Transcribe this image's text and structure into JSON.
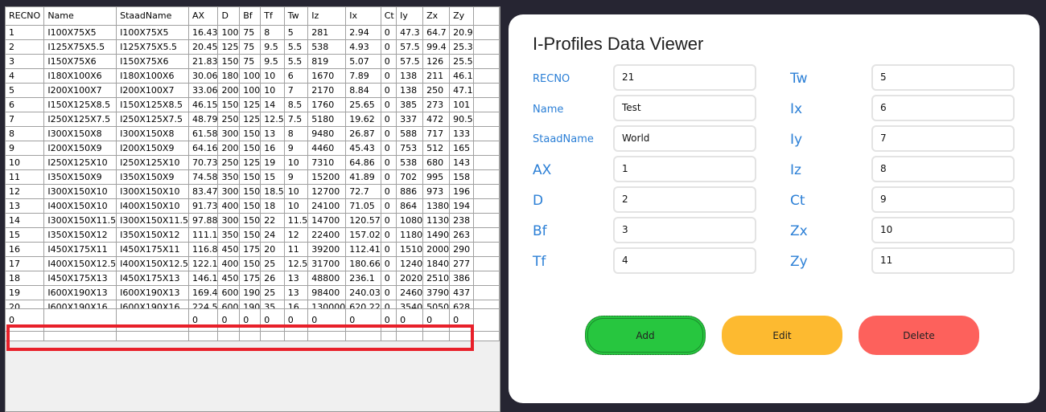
{
  "grid": {
    "columns": [
      "RECNO",
      "Name",
      "StaadName",
      "AX",
      "D",
      "Bf",
      "Tf",
      "Tw",
      "Iz",
      "Ix",
      "Ct",
      "Iy",
      "Zx",
      "Zy"
    ],
    "rows": [
      [
        "1",
        "I100X75X5",
        "I100X75X5",
        "16.43",
        "100",
        "75",
        "8",
        "5",
        "281",
        "2.94",
        "0",
        "47.3",
        "64.7",
        "20.9"
      ],
      [
        "2",
        "I125X75X5.5",
        "I125X75X5.5",
        "20.45",
        "125",
        "75",
        "9.5",
        "5.5",
        "538",
        "4.93",
        "0",
        "57.5",
        "99.4",
        "25.3"
      ],
      [
        "3",
        "I150X75X6",
        "I150X75X6",
        "21.83",
        "150",
        "75",
        "9.5",
        "5.5",
        "819",
        "5.07",
        "0",
        "57.5",
        "126",
        "25.5"
      ],
      [
        "4",
        "I180X100X6",
        "I180X100X6",
        "30.06",
        "180",
        "100",
        "10",
        "6",
        "1670",
        "7.89",
        "0",
        "138",
        "211",
        "46.1"
      ],
      [
        "5",
        "I200X100X7",
        "I200X100X7",
        "33.06",
        "200",
        "100",
        "10",
        "7",
        "2170",
        "8.84",
        "0",
        "138",
        "250",
        "47.1"
      ],
      [
        "6",
        "I150X125X8.5",
        "I150X125X8.5",
        "46.15",
        "150",
        "125",
        "14",
        "8.5",
        "1760",
        "25.65",
        "0",
        "385",
        "273",
        "101"
      ],
      [
        "7",
        "I250X125X7.5",
        "I250X125X7.5",
        "48.79",
        "250",
        "125",
        "12.5",
        "7.5",
        "5180",
        "19.62",
        "0",
        "337",
        "472",
        "90.5"
      ],
      [
        "8",
        "I300X150X8",
        "I300X150X8",
        "61.58",
        "300",
        "150",
        "13",
        "8",
        "9480",
        "26.87",
        "0",
        "588",
        "717",
        "133"
      ],
      [
        "9",
        "I200X150X9",
        "I200X150X9",
        "64.16",
        "200",
        "150",
        "16",
        "9",
        "4460",
        "45.43",
        "0",
        "753",
        "512",
        "165"
      ],
      [
        "10",
        "I250X125X10",
        "I250X125X10",
        "70.73",
        "250",
        "125",
        "19",
        "10",
        "7310",
        "64.86",
        "0",
        "538",
        "680",
        "143"
      ],
      [
        "11",
        "I350X150X9",
        "I350X150X9",
        "74.58",
        "350",
        "150",
        "15",
        "9",
        "15200",
        "41.89",
        "0",
        "702",
        "995",
        "158"
      ],
      [
        "12",
        "I300X150X10",
        "I300X150X10",
        "83.47",
        "300",
        "150",
        "18.5",
        "10",
        "12700",
        "72.7",
        "0",
        "886",
        "973",
        "196"
      ],
      [
        "13",
        "I400X150X10",
        "I400X150X10",
        "91.73",
        "400",
        "150",
        "18",
        "10",
        "24100",
        "71.05",
        "0",
        "864",
        "1380",
        "194"
      ],
      [
        "14",
        "I300X150X11.5",
        "I300X150X11.5",
        "97.88",
        "300",
        "150",
        "22",
        "11.5",
        "14700",
        "120.57",
        "0",
        "1080",
        "1130",
        "238"
      ],
      [
        "15",
        "I350X150X12",
        "I350X150X12",
        "111.1",
        "350",
        "150",
        "24",
        "12",
        "22400",
        "157.02",
        "0",
        "1180",
        "1490",
        "263"
      ],
      [
        "16",
        "I450X175X11",
        "I450X175X11",
        "116.8",
        "450",
        "175",
        "20",
        "11",
        "39200",
        "112.41",
        "0",
        "1510",
        "2000",
        "290"
      ],
      [
        "17",
        "I400X150X12.5",
        "I400X150X12.5",
        "122.1",
        "400",
        "150",
        "25",
        "12.5",
        "31700",
        "180.66",
        "0",
        "1240",
        "1840",
        "277"
      ],
      [
        "18",
        "I450X175X13",
        "I450X175X13",
        "146.1",
        "450",
        "175",
        "26",
        "13",
        "48800",
        "236.1",
        "0",
        "2020",
        "2510",
        "386"
      ],
      [
        "19",
        "I600X190X13",
        "I600X190X13",
        "169.4",
        "600",
        "190",
        "25",
        "13",
        "98400",
        "240.03",
        "0",
        "2460",
        "3790",
        "437"
      ]
    ],
    "partial_row": [
      "20",
      "I600X190X16",
      "I600X190X16",
      "224.5",
      "600",
      "190",
      "35",
      "16",
      "130000",
      "620.22",
      "0",
      "3540",
      "5050",
      "628"
    ],
    "new_row": [
      "0",
      "",
      "",
      "0",
      "0",
      "0",
      "0",
      "0",
      "0",
      "0",
      "0",
      "0",
      "0",
      "0"
    ]
  },
  "viewer": {
    "title": "I-Profiles Data Viewer",
    "labels": {
      "recno": "RECNO",
      "name": "Name",
      "staadname": "StaadName",
      "ax": "AX",
      "d": "D",
      "bf": "Bf",
      "tf": "Tf",
      "tw": "Tw",
      "ix": "Ix",
      "iy": "Iy",
      "iz": "Iz",
      "ct": "Ct",
      "zx": "Zx",
      "zy": "Zy"
    },
    "values": {
      "recno": "21",
      "name": "Test",
      "staadname": "World",
      "ax": "1",
      "d": "2",
      "bf": "3",
      "tf": "4",
      "tw": "5",
      "ix": "6",
      "iy": "7",
      "iz": "8",
      "ct": "9",
      "zx": "10",
      "zy": "11"
    },
    "buttons": {
      "add": "Add",
      "edit": "Edit",
      "delete": "Delete"
    }
  },
  "colors": {
    "accent_blue": "#2b7fd6",
    "add": "#27c63f",
    "edit": "#fdba30",
    "delete": "#fd615c",
    "highlight": "#e8202a"
  }
}
